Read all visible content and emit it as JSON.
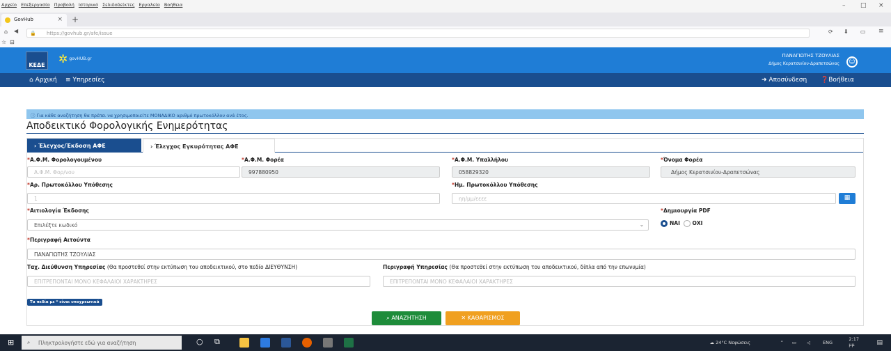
{
  "browser": {
    "menu": [
      "Αρχείο",
      "Επεξεργασία",
      "Προβολή",
      "Ιστορικό",
      "Σελιδοδείκτες",
      "Εργαλεία",
      "Βοήθεια"
    ],
    "tab_title": "GovHub",
    "tab_close": "×",
    "new_tab": "+",
    "url": "https://govhub.gr/afe/issue",
    "window_controls": [
      "–",
      "□",
      "×"
    ]
  },
  "site": {
    "logo_text": "ΚΕΔΕ",
    "sublogo_text": "govHUB.gr",
    "user_name": "ΠΑΝΑΓΙΩΤΗΣ ΤΖΟΥΛΙΑΣ",
    "user_org": "Δήμος Κερατσινίου-Δραπετσώνας",
    "nav": {
      "home": "Αρχική",
      "services": "Υπηρεσίες",
      "logout": "Αποσύνδεση",
      "help": "Βοήθεια"
    }
  },
  "page": {
    "alert": "Για κάθε αναζήτηση θα πρέπει να χρησιμοποιείτε ΜΟΝΑΔΙΚΟ αριθμό πρωτοκόλλου ανά έτος.",
    "title": "Αποδεικτικό Φορολογικής Ενημερότητας",
    "tabs": [
      "Έλεγχος/Έκδοση ΑΦΕ",
      "Έλεγχος Εγκυρότητας ΑΦΕ"
    ],
    "fields": {
      "afm_taxpayer": {
        "label": "Α.Φ.Μ. Φορολογουμένου",
        "placeholder": "Α.Φ.Μ. Φορ/νου"
      },
      "afm_agency": {
        "label": "Α.Φ.Μ. Φορέα",
        "value": "997880950"
      },
      "afm_employee": {
        "label": "Α.Φ.Μ. Υπαλλήλου",
        "value": "058829320"
      },
      "agency_name": {
        "label": "Όνομα Φορέα",
        "value": "Δήμος Κερατσινίου-Δραπετσώνας"
      },
      "protocol_no": {
        "label": "Αρ. Πρωτοκόλλου Υπόθεσης",
        "placeholder": "1"
      },
      "protocol_date": {
        "label": "Ημ. Πρωτοκόλλου Υπόθεσης",
        "placeholder": "ηη/μμ/εεεε"
      },
      "reason": {
        "label": "Αιτιολογία Έκδοσης",
        "value": "Επιλέξτε κωδικό"
      },
      "pdf": {
        "label": "Δημιουργία PDF",
        "yes": "ΝΑΙ",
        "no": "ΟΧΙ"
      },
      "applicant": {
        "label": "Περιγραφή Αιτούντα",
        "value": "ΠΑΝΑΓΙΩΤΗΣ ΤΖΟΥΛΙΑΣ"
      },
      "address": {
        "label": "Ταχ. Διεύθυνση Υπηρεσίας",
        "note": "(Θα προστεθεί στην εκτύπωση του αποδεικτικού, στο πεδίο ΔΙΕΥΘΥΝΣΗ)",
        "placeholder": "ΕΠΙΤΡΕΠΟΝΤΑΙ ΜΟΝΟ ΚΕΦΑΛΑΙΟΙ ΧΑΡΑΚΤΗΡΕΣ"
      },
      "service_desc": {
        "label": "Περιγραφή Υπηρεσίας",
        "note": "(Θα προστεθεί στην εκτύπωση του αποδεικτικού, δίπλα από την επωνυμία)",
        "placeholder": "ΕΠΙΤΡΕΠΟΝΤΑΙ ΜΟΝΟ ΚΕΦΑΛΑΙΟΙ ΧΑΡΑΚΤΗΡΕΣ"
      }
    },
    "required_note": "Τα πεδία με * είναι υποχρεωτικά",
    "search_button": "ΑΝΑΖΗΤΗΣΗ",
    "clear_button": "ΚΑΘΑΡΙΣΜΟΣ"
  },
  "taskbar": {
    "search_placeholder": "Πληκτρολογήστε εδώ για αναζήτηση",
    "weather": "24°C Νεφώσεις",
    "lang": "ENG",
    "time": "2:17 μμ"
  },
  "colors": {
    "header_blue": "#1f7dd6",
    "nav_dark": "#1a4e8f",
    "search_green": "#1e8c3a",
    "clear_orange": "#f0a020"
  }
}
